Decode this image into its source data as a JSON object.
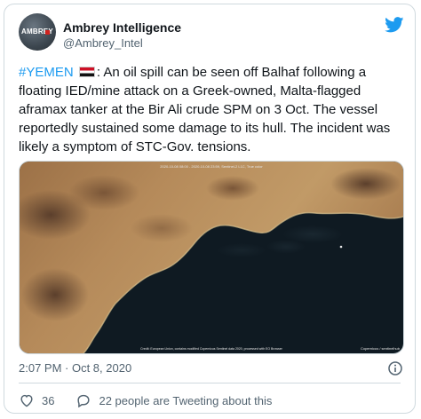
{
  "tweet": {
    "author": {
      "name": "Ambrey Intelligence",
      "handle": "@Ambrey_Intel",
      "avatar_text": "AMBREY"
    },
    "hashtag": "#YEMEN",
    "flag": "yemen-flag",
    "body": ": An oil spill can be seen off Balhaf following a floating IED/mine attack on a Greek-owned, Malta-flagged aframax tanker at the Bir Ali crude SPM on 3 Oct. The vessel reportedly sustained some damage to its hull. The incident was likely a symptom of STC-Gov. tensions.",
    "timestamp": "2:07 PM · Oct 8, 2020",
    "likes": "36",
    "tweeting_about": "22 people are Tweeting about this"
  },
  "media": {
    "description": "satellite-image-oil-spill-balhaf",
    "header_caption": "2020-10-08 08:00 - 2020-10-08 23:59, Sentinel-2 L1C, True color",
    "credit_caption": "Credit: European Union, contains modified Copernicus Sentinel data 2020, processed with EO Browser",
    "logo_text": "Copernicus / sentinelhub"
  },
  "colors": {
    "link": "#1d9bf0",
    "muted": "#536471",
    "border": "#cfd9de",
    "sea": "#0f1a22",
    "land": "#b08553"
  },
  "icons": {
    "brand": "twitter-bird-icon",
    "info": "info-icon",
    "like": "heart-icon",
    "reply": "speech-bubble-icon"
  }
}
